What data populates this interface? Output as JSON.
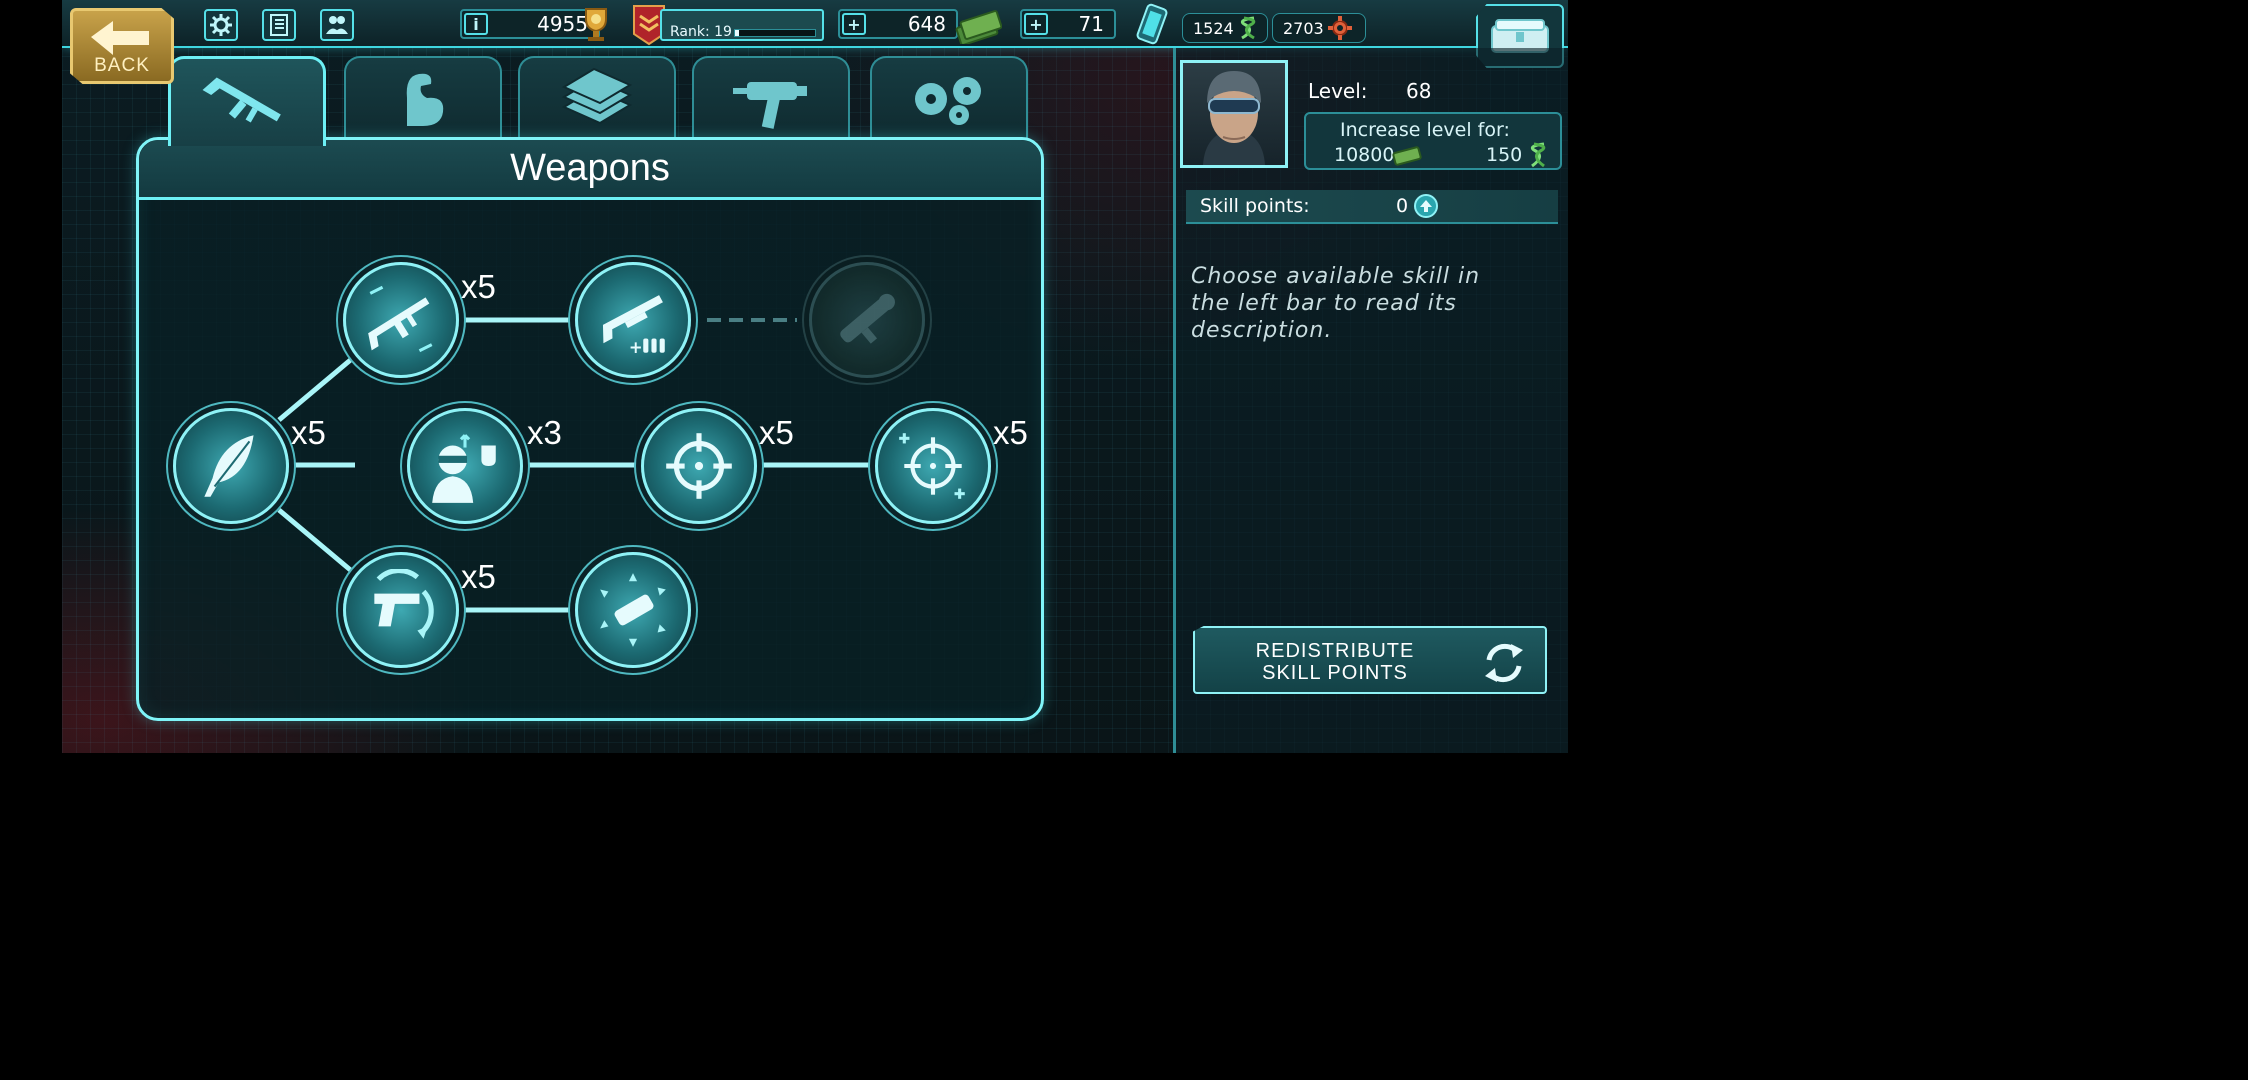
{
  "topbar": {
    "back_label": "BACK",
    "trophies": "4955",
    "rank_label": "Rank: 19",
    "rank_progress": 0.05,
    "cash": "648",
    "crystals": "71",
    "dna": "1524",
    "parts": "2703"
  },
  "tabs": [
    {
      "icon": "rifle-icon",
      "active": true
    },
    {
      "icon": "muscle-arm-icon",
      "active": false
    },
    {
      "icon": "money-stack-icon",
      "active": false
    },
    {
      "icon": "syringe-gun-icon",
      "active": false
    },
    {
      "icon": "gears-icon",
      "active": false
    }
  ],
  "panel": {
    "title": "Weapons"
  },
  "skill_tree": {
    "nodes": [
      {
        "id": "lightweight",
        "icon": "feather-icon",
        "multiplier": "x5",
        "locked": false
      },
      {
        "id": "assault-rifle",
        "icon": "assault-rifle-icon",
        "multiplier": "x5",
        "locked": false
      },
      {
        "id": "shotgun-ammo",
        "icon": "shotgun-ammo-icon",
        "multiplier": "",
        "locked": false
      },
      {
        "id": "rocket-launcher",
        "icon": "rocket-launcher-icon",
        "multiplier": "",
        "locked": true
      },
      {
        "id": "strength",
        "icon": "soldier-fist-icon",
        "multiplier": "x3",
        "locked": false
      },
      {
        "id": "aim",
        "icon": "crosshair-icon",
        "multiplier": "x5",
        "locked": false
      },
      {
        "id": "aim-plus",
        "icon": "crosshair-plus-icon",
        "multiplier": "x5",
        "locked": false
      },
      {
        "id": "pistol-reload",
        "icon": "pistol-reload-icon",
        "multiplier": "x5",
        "locked": false
      },
      {
        "id": "explosion",
        "icon": "shell-burst-icon",
        "multiplier": "",
        "locked": false
      }
    ]
  },
  "character": {
    "level_label": "Level:",
    "level_value": "68",
    "increase_label": "Increase level for:",
    "increase_money": "10800",
    "increase_dna": "150",
    "skill_points_label": "Skill  points:",
    "skill_points_value": "0",
    "description": "Choose available skill in the left bar to read its description.",
    "redistribute_label": "REDISTRIBUTE SKILL POINTS"
  },
  "colors": {
    "accent": "#6df0f5",
    "panel_bg": "#0f2a2f",
    "back_gold": "#c8a24a"
  }
}
